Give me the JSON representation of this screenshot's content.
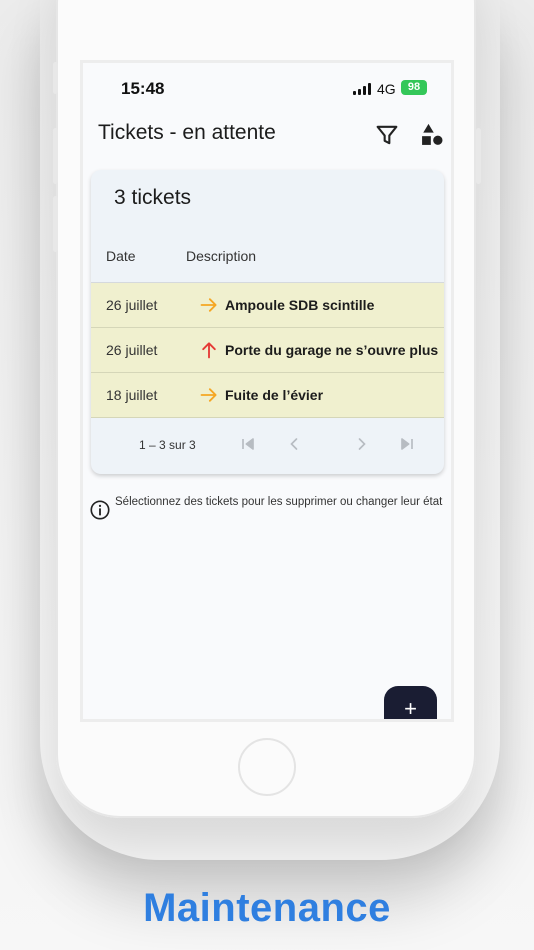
{
  "status_bar": {
    "time": "15:48",
    "network": "4G",
    "battery": "98"
  },
  "app_bar": {
    "title": "Tickets - en attente",
    "filter_icon": "filter-icon",
    "category_icon": "shapes-icon"
  },
  "table": {
    "count_title": "3 tickets",
    "columns": [
      "Date",
      "Description"
    ],
    "rows": [
      {
        "date": "26 juillet",
        "priority": "normal",
        "priority_color": "#f5a623",
        "description": "Ampoule SDB scintille"
      },
      {
        "date": "26 juillet",
        "priority": "high",
        "priority_color": "#e53935",
        "description": "Porte du garage ne s’ouvre plus"
      },
      {
        "date": "18 juillet",
        "priority": "normal",
        "priority_color": "#f5a623",
        "description": "Fuite de l’évier"
      }
    ],
    "pagination": {
      "range": "1 – 3 sur 3"
    }
  },
  "info": {
    "text": "Sélectionnez des tickets pour les supprimer ou changer leur état"
  },
  "fab": {
    "label": "+"
  },
  "brand": {
    "title": "Maintenance",
    "color": "#2f7fe0"
  },
  "colors": {
    "row_bg": "#f0f0cf",
    "card_bg": "#eef3f8",
    "fab_bg": "#1a1d33",
    "battery": "#34c759"
  }
}
